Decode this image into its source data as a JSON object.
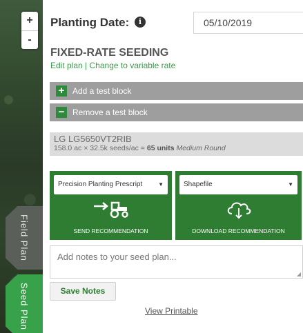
{
  "map": {
    "zoom_in": "+",
    "zoom_out": "-",
    "tabs": {
      "field_plan": "Field Plan",
      "seed_plan": "Seed Plan"
    }
  },
  "planting": {
    "label": "Planting Date:",
    "info_icon": "info-circle-icon",
    "date_value": "05/10/2019"
  },
  "plan": {
    "heading": "FIXED-RATE SEEDING",
    "edit_link": "Edit plan",
    "separator": "|",
    "variable_link": "Change to variable rate"
  },
  "test_block": {
    "add_symbol": "+",
    "add_label": "Add a test block",
    "remove_symbol": "−",
    "remove_label": "Remove a test block"
  },
  "product": {
    "name": "LG LG5650VT2RIB",
    "detail_prefix": "158.0 ac × 32.5k seeds/ac = ",
    "units": "65 units",
    "seed_size": "Medium Round"
  },
  "send": {
    "select_value": "Precision Planting Prescript",
    "icon": "tractor-arrow-icon",
    "label": "SEND RECOMMENDATION"
  },
  "download": {
    "select_value": "Shapefile",
    "icon": "cloud-download-icon",
    "label": "DOWNLOAD RECOMMENDATION"
  },
  "notes": {
    "placeholder": "Add notes to your seed plan...",
    "save_label": "Save Notes"
  },
  "print": {
    "label": "View Printable"
  },
  "colors": {
    "accent_green": "#2e7d32",
    "link_green": "#3a9a4a",
    "tab_active": "#37a24a",
    "bar_gray": "#9e9e9e"
  }
}
